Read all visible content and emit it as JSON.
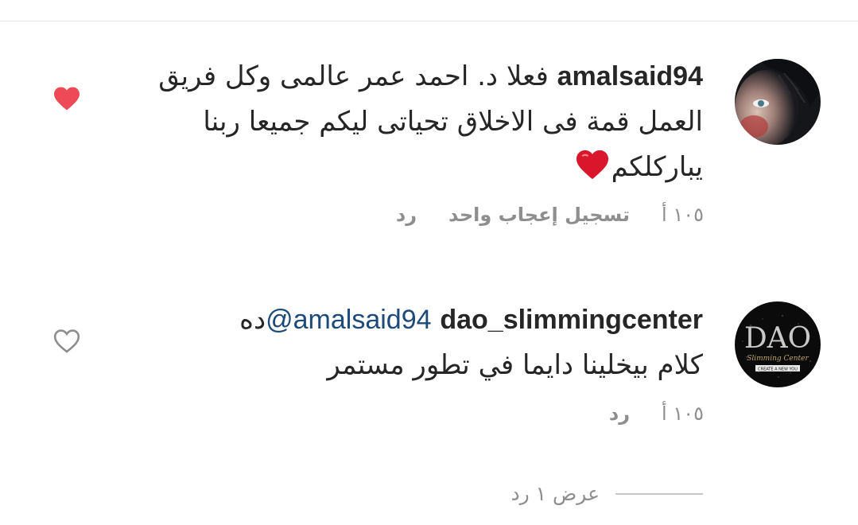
{
  "comments": [
    {
      "username": "amalsaid94",
      "lines": [
        "فعلا د. احمد عمر عالمى وكل فريق",
        "العمل قمة فى الاخلاق تحياتى ليكم جميعا ربنا",
        "يباركلكم"
      ],
      "emoji": "red-heart",
      "time": "١٠٥ أ",
      "action_like_label": "تسجيل إعجاب واحد",
      "action_reply_label": "رد",
      "liked": true
    },
    {
      "username": "dao_slimmingcenter",
      "mention": "@amalsaid94",
      "mention_suffix": "ده",
      "line2": "كلام بيخلينا دايما في تطور مستمر",
      "time": "١٠٥ أ",
      "action_reply_label": "رد",
      "liked": false,
      "avatar_text": "DAO",
      "avatar_sub": "Slimming Center",
      "avatar_tag": "CREATE A NEW YOU"
    }
  ],
  "view_replies": "عرض ١ رد",
  "colors": {
    "like_red": "#ed4956",
    "meta_gray": "#8e8e8e",
    "mention_blue": "#1c4a7a",
    "text": "#262626"
  }
}
